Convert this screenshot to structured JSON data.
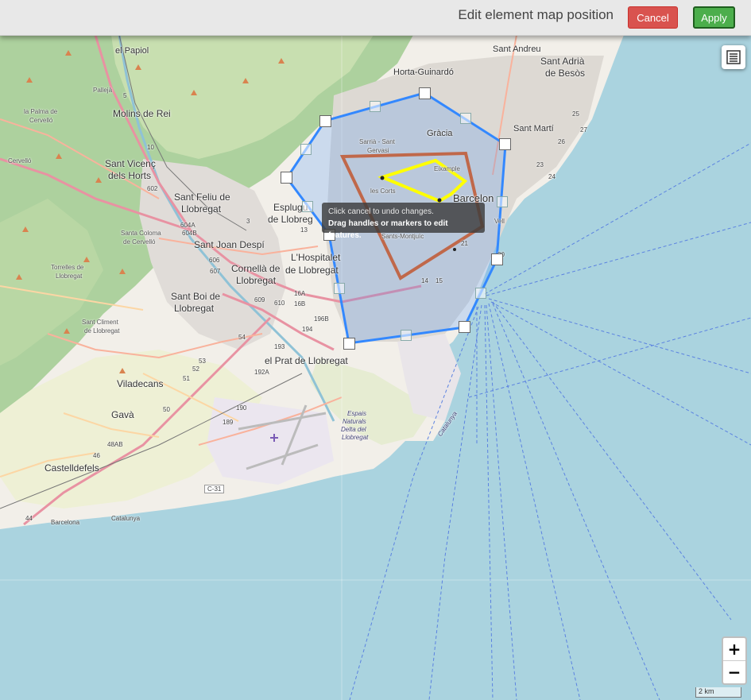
{
  "toolbar": {
    "title": "Edit element map position",
    "cancel_label": "Cancel",
    "apply_label": "Apply"
  },
  "tooltip": {
    "line1": "Click cancel to undo changes.",
    "line2": "Drag handles or markers to edit features."
  },
  "map_controls": {
    "zoom_in": "+",
    "zoom_out": "−",
    "scale": "2 km",
    "layers_icon": "layers-list-icon"
  },
  "colors": {
    "sea": "#aad3df",
    "polygon_stroke": "#3388ff",
    "rectangle_stroke": "#c0684a",
    "polyline_stroke": "#ffff00",
    "cancel": "#d9534f",
    "apply": "#4cae4c"
  },
  "places": {
    "el_papiol": "el Papiol",
    "sant_andreu": "Sant Andreu",
    "sant_adria_1": "Sant Adrià",
    "sant_adria_2": "de Besòs",
    "horta": "Horta-Guinardó",
    "palleja": "Pallejà",
    "molins": "Molins de Rei",
    "la_palma_1": "la Palma de",
    "la_palma_2": "Cervelló",
    "gracia": "Gràcia",
    "sant_marti": "Sant Martí",
    "sarria_1": "Sarrià - Sant",
    "sarria_2": "Gervasi",
    "cervello": "Cervelló",
    "sant_vicenc_1": "Sant Vicenç",
    "sant_vicenc_2": "dels Horts",
    "eixample": "Eixample",
    "les_corts": "les Corts",
    "barcelona": "Barcelon",
    "ciutat_vell": "Vell",
    "sant_feliu_1": "Sant Feliu de",
    "sant_feliu_2": "Llobregat",
    "esplugues_1": "Esplugu",
    "esplugues_2": "de Llobreg",
    "santa_coloma_1": "Santa Coloma",
    "santa_coloma_2": "de Cervelló",
    "sant_joan": "Sant Joan Despí",
    "sants": "Sants-Montjuïc",
    "hospitalet_1": "L'Hospitalet",
    "hospitalet_2": "de Llobregat",
    "torrelles_1": "Torrelles de",
    "torrelles_2": "Llobregat",
    "cornella_1": "Cornellà de",
    "cornella_2": "Llobregat",
    "sant_boi_1": "Sant Boi de",
    "sant_boi_2": "Llobregat",
    "sant_climent_1": "Sant Climent",
    "sant_climent_2": "de Llobregat",
    "el_prat": "el Prat de Llobregat",
    "viladecans": "Viladecans",
    "gava": "Gavà",
    "castelldefels": "Castelldefels",
    "espais_1": "Espais",
    "espais_2": "Naturals",
    "espais_3": "Delta del",
    "espais_4": "Llobregat",
    "catalunya": "Catalunya",
    "barcelona_road": "Barcelona",
    "catalunya_road": "Catalunya",
    "c31": "C-31"
  },
  "roads": [
    "5",
    "10",
    "602",
    "604A",
    "604B",
    "606",
    "607",
    "609",
    "610",
    "16A",
    "16B",
    "196B",
    "194",
    "193",
    "54",
    "53",
    "52",
    "51",
    "192A",
    "50",
    "189",
    "190",
    "48AB",
    "46",
    "44",
    "3",
    "13",
    "14",
    "15",
    "20",
    "21",
    "23",
    "24",
    "25",
    "26",
    "27"
  ]
}
